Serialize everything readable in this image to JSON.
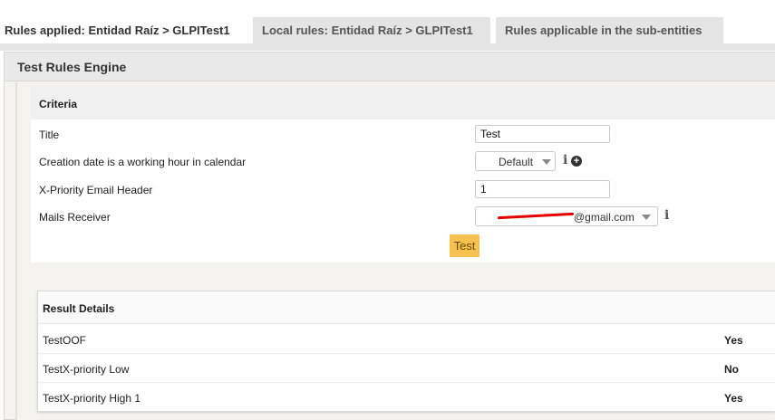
{
  "tabs": {
    "active": "Rules applied: Entidad Raíz > GLPITest1",
    "local": "Local rules: Entidad Raíz > GLPITest1",
    "sub": "Rules applicable in the sub-entities"
  },
  "engine": {
    "title": "Test Rules Engine"
  },
  "criteria": {
    "heading": "Criteria",
    "title_label": "Title",
    "title_value": "Test",
    "creation_label": "Creation date is a working hour in calendar",
    "creation_value": "Default",
    "priority_label": "X-Priority Email Header",
    "priority_value": "1",
    "receiver_label": "Mails Receiver",
    "receiver_value": "@gmail.com",
    "test_button": "Test",
    "info_icon": "info-icon",
    "add_icon": "plus-circle-icon"
  },
  "results": {
    "heading": "Result Details",
    "rows": [
      {
        "name": "TestOOF",
        "value": "Yes"
      },
      {
        "name": "TestX-priority Low",
        "value": "No"
      },
      {
        "name": "TestX-priority High 1",
        "value": "Yes"
      }
    ]
  },
  "colors": {
    "test_button": "#f6c24f",
    "tab_bg": "#e4e4e4",
    "panel_bg": "#f4f3ef"
  }
}
